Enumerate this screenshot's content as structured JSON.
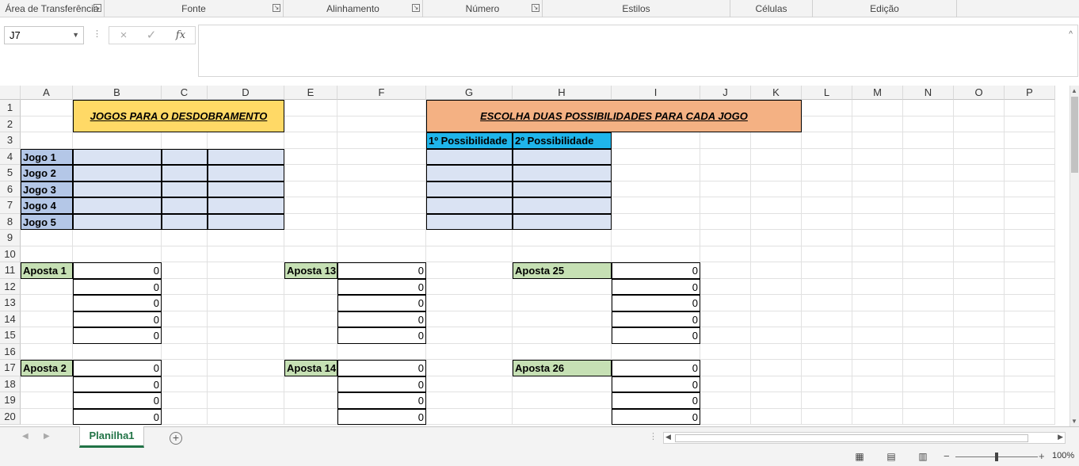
{
  "ribbon": {
    "groups": [
      "Área de Transferência",
      "Fonte",
      "Alinhamento",
      "Número",
      "Estilos",
      "Células",
      "Edição"
    ]
  },
  "formula_bar": {
    "name_box": "J7",
    "cancel_icon": "×",
    "enter_icon": "✓",
    "fx_label": "fx",
    "content": ""
  },
  "columns": [
    "A",
    "B",
    "C",
    "D",
    "E",
    "F",
    "G",
    "H",
    "I",
    "J",
    "K",
    "L",
    "M",
    "N",
    "O",
    "P"
  ],
  "rows": [
    "1",
    "2",
    "3",
    "4",
    "5",
    "6",
    "7",
    "8",
    "9",
    "10",
    "11",
    "12",
    "13",
    "14",
    "15",
    "16",
    "17",
    "18",
    "19",
    "20"
  ],
  "sheet": {
    "title_left": "JOGOS PARA O DESDOBRAMENTO",
    "title_right": "ESCOLHA DUAS POSSIBILIDADES PARA CADA JOGO",
    "col_g_header": "1º Possibilidade",
    "col_h_header": "2º Possibilidade",
    "jogos": [
      "Jogo 1",
      "Jogo 2",
      "Jogo 3",
      "Jogo 4",
      "Jogo 5"
    ],
    "apostas": [
      {
        "label": "Aposta 1",
        "values": [
          "0",
          "0",
          "0",
          "0",
          "0"
        ]
      },
      {
        "label": "Aposta 13",
        "values": [
          "0",
          "0",
          "0",
          "0",
          "0"
        ]
      },
      {
        "label": "Aposta 25",
        "values": [
          "0",
          "0",
          "0",
          "0",
          "0"
        ]
      },
      {
        "label": "Aposta 2",
        "values": [
          "0",
          "0",
          "0",
          "0"
        ]
      },
      {
        "label": "Aposta 14",
        "values": [
          "0",
          "0",
          "0",
          "0"
        ]
      },
      {
        "label": "Aposta 26",
        "values": [
          "0",
          "0",
          "0",
          "0"
        ]
      }
    ]
  },
  "tabs": {
    "active": "Planilha1",
    "add_icon": "+"
  },
  "status": {
    "zoom": "100%",
    "zoom_level_percent": 100
  },
  "colors": {
    "title_left_bg": "#ffd966",
    "title_right_bg": "#f4b183",
    "possibility_header_bg": "#1fb5ea",
    "input_bg": "#dae3f3",
    "jogo_label_bg": "#b4c7e7",
    "aposta_label_bg": "#c6e0b4",
    "accent": "#217346"
  }
}
